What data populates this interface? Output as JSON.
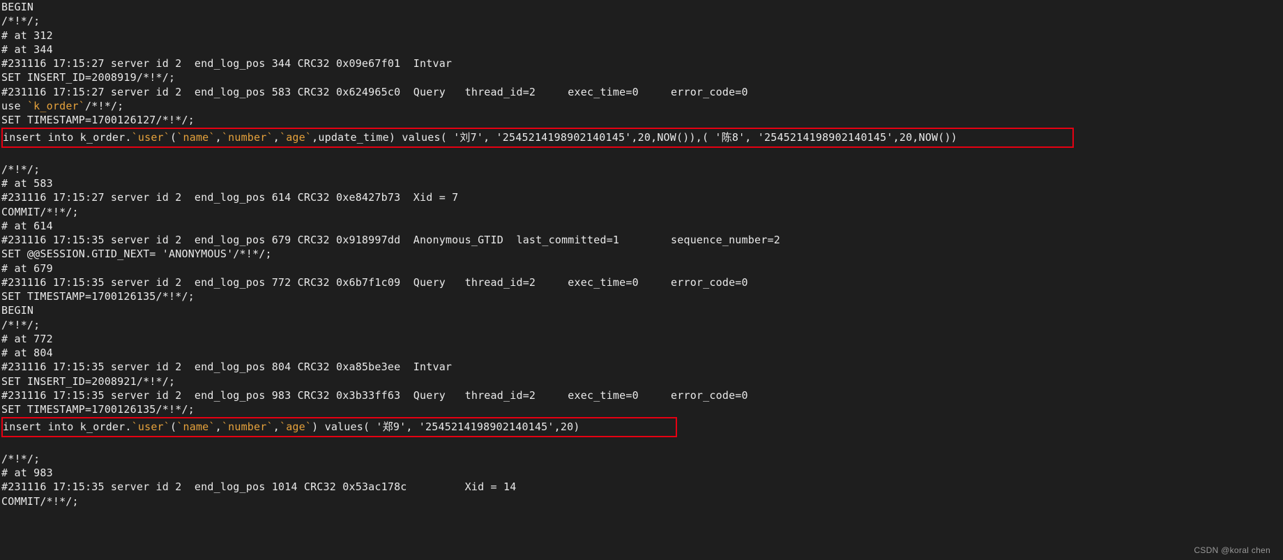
{
  "lines": {
    "l0": "BEGIN",
    "l1": "/*!*/;",
    "l2": "# at 312",
    "l3": "# at 344",
    "l4": "#231116 17:15:27 server id 2  end_log_pos 344 CRC32 0x09e67f01  Intvar",
    "l5": "SET INSERT_ID=2008919/*!*/;",
    "l6": "#231116 17:15:27 server id 2  end_log_pos 583 CRC32 0x624965c0  Query   thread_id=2     exec_time=0     error_code=0",
    "l7a": "use ",
    "l7b": "`k_order`",
    "l7c": "/*!*/;",
    "l8": "SET TIMESTAMP=1700126127/*!*/;",
    "box1": {
      "p1": "insert into k_order.",
      "p2": "`user`",
      "p3": "(",
      "p4": "`name`",
      "p5": ",",
      "p6": "`number`",
      "p7": ",",
      "p8": "`age`",
      "p9": ",update_time) values( '刘7', '2545214198902140145',20,NOW()),( '陈8', '2545214198902140145',20,NOW())"
    },
    "l9": "/*!*/;",
    "l10": "# at 583",
    "l11": "#231116 17:15:27 server id 2  end_log_pos 614 CRC32 0xe8427b73  Xid = 7",
    "l12": "COMMIT/*!*/;",
    "l13": "# at 614",
    "l14": "#231116 17:15:35 server id 2  end_log_pos 679 CRC32 0x918997dd  Anonymous_GTID  last_committed=1        sequence_number=2",
    "l15": "SET @@SESSION.GTID_NEXT= 'ANONYMOUS'/*!*/;",
    "l16": "# at 679",
    "l17": "#231116 17:15:35 server id 2  end_log_pos 772 CRC32 0x6b7f1c09  Query   thread_id=2     exec_time=0     error_code=0",
    "l18": "SET TIMESTAMP=1700126135/*!*/;",
    "l19": "BEGIN",
    "l20": "/*!*/;",
    "l21": "# at 772",
    "l22": "# at 804",
    "l23": "#231116 17:15:35 server id 2  end_log_pos 804 CRC32 0xa85be3ee  Intvar",
    "l24": "SET INSERT_ID=2008921/*!*/;",
    "l25": "#231116 17:15:35 server id 2  end_log_pos 983 CRC32 0x3b33ff63  Query   thread_id=2     exec_time=0     error_code=0",
    "l26": "SET TIMESTAMP=1700126135/*!*/;",
    "box2": {
      "p1": "insert into k_order.",
      "p2": "`user`",
      "p3": "(",
      "p4": "`name`",
      "p5": ",",
      "p6": "`number`",
      "p7": ",",
      "p8": "`age`",
      "p9": ") values( '郑9', '2545214198902140145',20)"
    },
    "l27": "/*!*/;",
    "l28": "# at 983",
    "l29": "#231116 17:15:35 server id 2  end_log_pos 1014 CRC32 0x53ac178c         Xid = 14",
    "l30": "COMMIT/*!*/;"
  },
  "watermark": "CSDN @koral chen",
  "box_widths": {
    "box1": "1534px",
    "box2": "965px"
  }
}
